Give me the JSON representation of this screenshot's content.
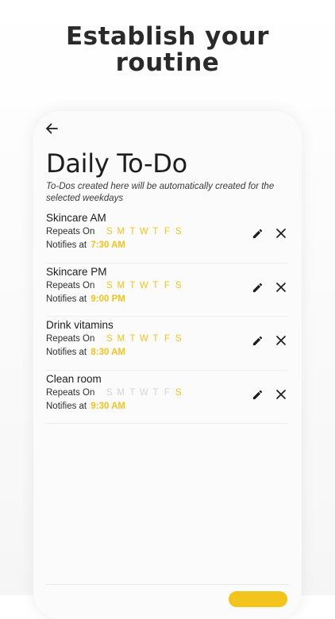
{
  "headline": {
    "line1": "Establish your",
    "line2": "routine"
  },
  "screen": {
    "title": "Daily To-Do",
    "subtitle": "To-Dos created here will be automatically created for the selected weekdays"
  },
  "colors": {
    "accent": "#f2c41c",
    "day_inactive": "#d3d3d3",
    "text": "#1e1e1e"
  },
  "icons": {
    "back": "arrow-left-icon",
    "edit": "pencil-icon",
    "delete": "close-icon"
  },
  "labels": {
    "repeats_on": "Repeats On",
    "notifies_at": "Notifies at"
  },
  "todos": [
    {
      "name": "Skincare AM",
      "time": "7:30 AM",
      "days": [
        {
          "letter": "S",
          "active": true
        },
        {
          "letter": "M",
          "active": true
        },
        {
          "letter": "T",
          "active": true
        },
        {
          "letter": "W",
          "active": true
        },
        {
          "letter": "T",
          "active": true
        },
        {
          "letter": "F",
          "active": true
        },
        {
          "letter": "S",
          "active": true
        }
      ]
    },
    {
      "name": "Skincare PM",
      "time": "9:00 PM",
      "days": [
        {
          "letter": "S",
          "active": true
        },
        {
          "letter": "M",
          "active": true
        },
        {
          "letter": "T",
          "active": true
        },
        {
          "letter": "W",
          "active": true
        },
        {
          "letter": "T",
          "active": true
        },
        {
          "letter": "F",
          "active": true
        },
        {
          "letter": "S",
          "active": true
        }
      ]
    },
    {
      "name": "Drink vitamins",
      "time": "8:30 AM",
      "days": [
        {
          "letter": "S",
          "active": true
        },
        {
          "letter": "M",
          "active": true
        },
        {
          "letter": "T",
          "active": true
        },
        {
          "letter": "W",
          "active": true
        },
        {
          "letter": "T",
          "active": true
        },
        {
          "letter": "F",
          "active": true
        },
        {
          "letter": "S",
          "active": true
        }
      ]
    },
    {
      "name": "Clean room",
      "time": "9:30 AM",
      "days": [
        {
          "letter": "S",
          "active": false
        },
        {
          "letter": "M",
          "active": false
        },
        {
          "letter": "T",
          "active": false
        },
        {
          "letter": "W",
          "active": false
        },
        {
          "letter": "T",
          "active": false
        },
        {
          "letter": "F",
          "active": false
        },
        {
          "letter": "S",
          "active": true
        }
      ]
    }
  ]
}
